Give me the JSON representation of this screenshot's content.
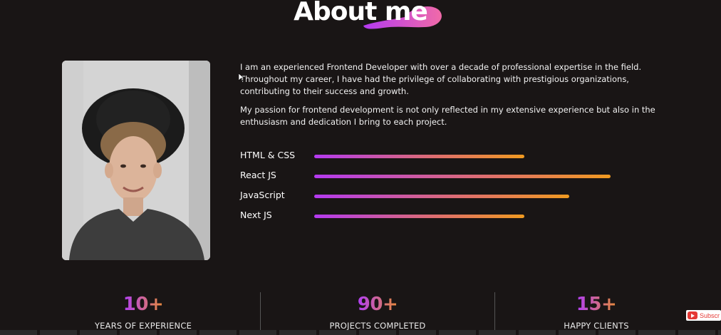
{
  "header": {
    "title": "About me"
  },
  "bio": {
    "paragraph_1": "I am an experienced Frontend Developer with over a decade of professional expertise in the field. Throughout my career, I have had the privilege of collaborating with prestigious organizations, contributing to their success and growth.",
    "paragraph_2": "My passion for frontend development is not only reflected in my extensive experience but also in the enthusiasm and dedication I bring to each project."
  },
  "skills": [
    {
      "label": "HTML & CSS",
      "level": 0.71
    },
    {
      "label": "React JS",
      "level": 1.0
    },
    {
      "label": "JavaScript",
      "level": 0.86
    },
    {
      "label": "Next JS",
      "level": 0.71
    }
  ],
  "stats": [
    {
      "value": "10+",
      "label": "YEARS OF EXPERIENCE"
    },
    {
      "value": "90+",
      "label": "PROJECTS COMPLETED"
    },
    {
      "value": "15+",
      "label": "HAPPY CLIENTS"
    }
  ],
  "overlay": {
    "subscribe_label": "Subscr"
  },
  "icons": {
    "photo": "profile-photo",
    "cursor": "mouse-cursor-icon",
    "subscribe": "youtube-icon"
  },
  "colors": {
    "background": "#191515",
    "gradient_start": "#b13ef5",
    "gradient_end": "#f09a20"
  }
}
